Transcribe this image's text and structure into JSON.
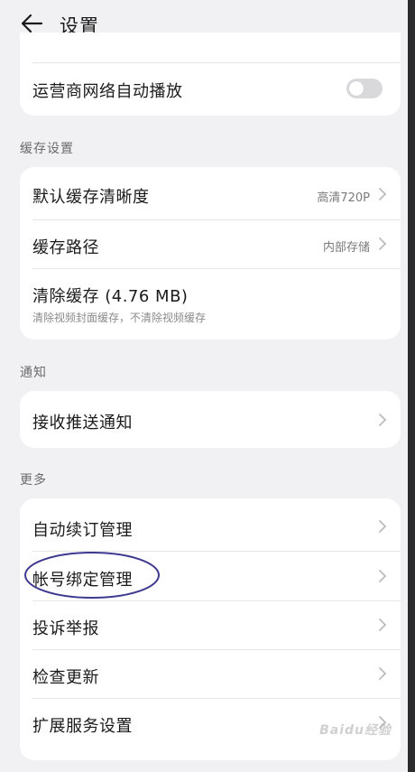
{
  "header": {
    "title": "设置"
  },
  "top_card": {
    "autoplay_label": "运营商网络自动播放",
    "autoplay_enabled": false
  },
  "sections": {
    "cache_title": "缓存设置",
    "notify_title": "通知",
    "more_title": "更多"
  },
  "cache_card": {
    "default_quality_label": "默认缓存清晰度",
    "default_quality_value": "高清720P",
    "path_label": "缓存路径",
    "path_value": "内部存储",
    "clear_label": "清除缓存 (4.76 MB)",
    "clear_sub": "清除视频封面缓存，不清除视频缓存"
  },
  "notify_card": {
    "push_label": "接收推送通知"
  },
  "more_card": {
    "auto_renew_label": "自动续订管理",
    "account_binding_label": "帐号绑定管理",
    "complaint_label": "投诉举报",
    "check_update_label": "检查更新",
    "extension_label": "扩展服务设置"
  },
  "watermark": "Baidu经验",
  "colors": {
    "background": "#f1f1f3",
    "card": "#ffffff",
    "annotation": "#3d3a8f",
    "toggle_off": "#d9d9dc"
  }
}
